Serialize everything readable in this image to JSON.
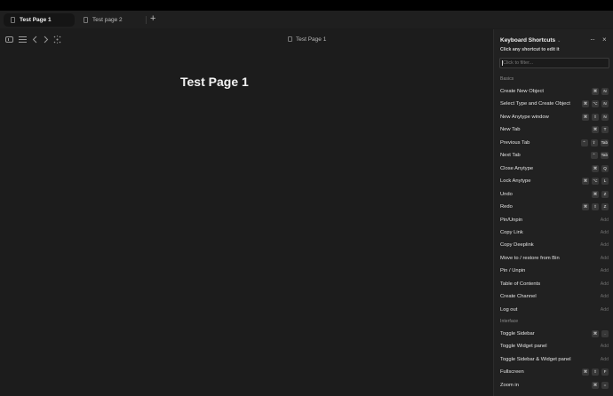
{
  "tabs": [
    {
      "label": "Test Page 1",
      "active": true
    },
    {
      "label": "Test page 2",
      "active": false
    }
  ],
  "new_tab_symbol": "+",
  "breadcrumb": "Test Page 1",
  "page_title": "Test Page 1",
  "panel": {
    "title": "Keyboard Shortcuts",
    "caret": "⌄",
    "subtitle": "Click any shortcut to edit it",
    "filter_placeholder": "Click to filter...",
    "more_symbol": "···",
    "close_symbol": "×",
    "sections": [
      {
        "label": "Basics"
      },
      {
        "label": "Interface"
      }
    ],
    "basics": [
      {
        "label": "Create New Object",
        "keys": [
          "⌘",
          "N"
        ]
      },
      {
        "label": "Select Type and Create Object",
        "keys": [
          "⌘",
          "⌥",
          "N"
        ]
      },
      {
        "label": "New Anytype window",
        "keys": [
          "⌘",
          "⇧",
          "N"
        ]
      },
      {
        "label": "New Tab",
        "keys": [
          "⌘",
          "T"
        ]
      },
      {
        "label": "Previous Tab",
        "keys": [
          "⌃",
          "⇧",
          "Tab"
        ]
      },
      {
        "label": "Next Tab",
        "keys": [
          "⌃",
          "Tab"
        ]
      },
      {
        "label": "Close Anytype",
        "keys": [
          "⌘",
          "Q"
        ]
      },
      {
        "label": "Lock Anytype",
        "keys": [
          "⌘",
          "⌥",
          "L"
        ]
      },
      {
        "label": "Undo",
        "keys": [
          "⌘",
          "Z"
        ]
      },
      {
        "label": "Redo",
        "keys": [
          "⌘",
          "⇧",
          "Z"
        ]
      },
      {
        "label": "Pin/Unpin",
        "add": "Add"
      },
      {
        "label": "Copy Link",
        "add": "Add"
      },
      {
        "label": "Copy Deeplink",
        "add": "Add"
      },
      {
        "label": "Move to / restore from Bin",
        "add": "Add"
      },
      {
        "label": "Pin / Unpin",
        "add": "Add"
      },
      {
        "label": "Table of Contents",
        "add": "Add"
      },
      {
        "label": "Create Channel",
        "add": "Add"
      },
      {
        "label": "Log out",
        "add": "Add"
      }
    ],
    "interface": [
      {
        "label": "Toggle Sidebar",
        "keys": [
          "⌘",
          "."
        ]
      },
      {
        "label": "Toggle Widget panel",
        "add": "Add"
      },
      {
        "label": "Toggle Sidebar & Widget panel",
        "add": "Add"
      },
      {
        "label": "Fullscreen",
        "keys": [
          "⌘",
          "⇧",
          "F"
        ]
      },
      {
        "label": "Zoom in",
        "keys": [
          "⌘",
          "="
        ]
      }
    ]
  },
  "toolbar_icons": [
    "sidebar-toggle-icon",
    "menu-icon",
    "back-icon",
    "forward-icon",
    "graph-icon"
  ],
  "colors": {
    "background": "#1c1c1c",
    "panel": "#212121",
    "key": "#383838"
  }
}
